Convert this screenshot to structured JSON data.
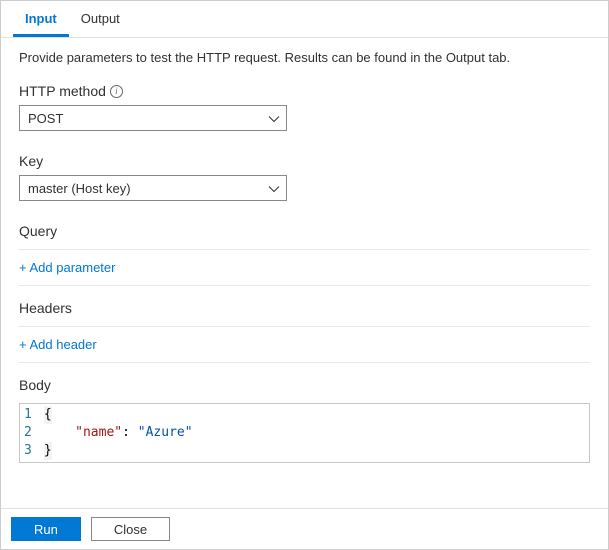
{
  "tabs": {
    "input": "Input",
    "output": "Output",
    "active": "input"
  },
  "description": "Provide parameters to test the HTTP request. Results can be found in the Output tab.",
  "http_method": {
    "label": "HTTP method",
    "value": "POST"
  },
  "key": {
    "label": "Key",
    "value": "master (Host key)"
  },
  "query": {
    "label": "Query",
    "add_link": "+ Add parameter"
  },
  "headers": {
    "label": "Headers",
    "add_link": "+ Add header"
  },
  "body": {
    "label": "Body",
    "lines": {
      "n1": "1",
      "n2": "2",
      "n3": "3",
      "brace_open": "{",
      "brace_close": "}",
      "key": "\"name\"",
      "colon": ": ",
      "value": "\"Azure\""
    }
  },
  "footer": {
    "run": "Run",
    "close": "Close"
  },
  "info_glyph": "i"
}
